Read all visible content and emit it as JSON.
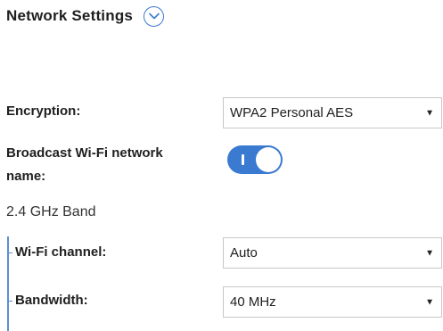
{
  "header": {
    "title": "Network Settings",
    "expand_icon": "chevron-down-icon"
  },
  "encryption": {
    "label": "Encryption:",
    "value": "WPA2 Personal AES"
  },
  "broadcast": {
    "label_line1": "Broadcast Wi-Fi network",
    "label_line2": "name:",
    "toggle_on": true
  },
  "band": {
    "label": "2.4 GHz Band",
    "channel": {
      "label": "Wi-Fi channel:",
      "value": "Auto"
    },
    "bandwidth": {
      "label": "Bandwidth:",
      "value": "40 MHz"
    }
  },
  "colors": {
    "accent": "#3a7ad1",
    "border": "#c8c8c8",
    "text": "#1f1f1f"
  },
  "icons": {
    "dropdown_caret": "▼"
  }
}
